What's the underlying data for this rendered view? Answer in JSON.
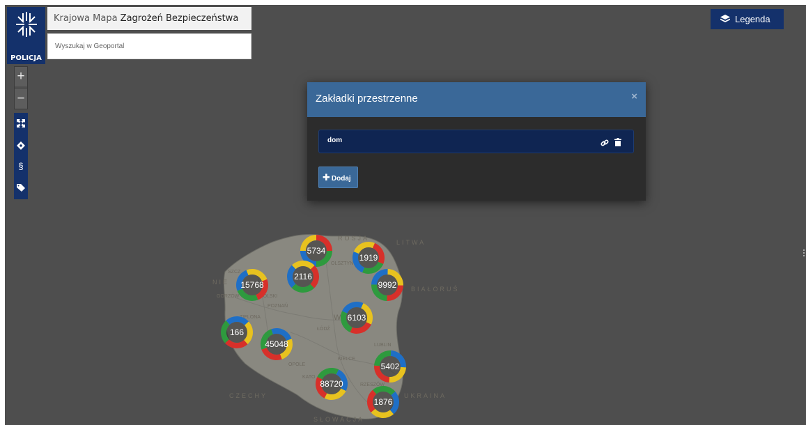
{
  "header": {
    "logo_text": "POLICJA",
    "title_prefix": "Krajowa Mapa ",
    "title_strong": "Zagrożeń Bezpieczeństwa",
    "search_placeholder": "Wyszukaj w Geoportal"
  },
  "zoom": {
    "in": "+",
    "out": "−"
  },
  "toolbar": {
    "items": [
      {
        "icon": "expand-icon"
      },
      {
        "icon": "locate-icon"
      },
      {
        "icon": "paragraph-icon",
        "glyph": "§"
      },
      {
        "icon": "tags-icon"
      }
    ]
  },
  "legend_button": {
    "label": "Legenda",
    "icon": "layers-icon"
  },
  "modal": {
    "title": "Zakładki przestrzenne",
    "close": "×",
    "bookmarks": [
      {
        "name": "dom"
      }
    ],
    "add_label": "Dodaj"
  },
  "map": {
    "labels": {
      "rosja": "ROSJA",
      "litwa": "LITWA",
      "bialorus": "BIAŁORUŚ",
      "niemcy": "NIE",
      "czechy": "CZECHY",
      "ukraina": "UKRAINA",
      "slowacja": "SŁOWACJA",
      "olsztyn": "OLSZTYN",
      "szczecin": "SZCZ",
      "gorzow": "GORZÓW",
      "poznan": "POZNAŃ",
      "zielona": "ZIELONA",
      "lodz": "ŁÓDŹ",
      "lublin": "LUBLIN",
      "kielce": "KIELCE",
      "opole": "OPOLE",
      "kato": "KATO",
      "rzeszow": "RZESZÓW",
      "polski": "POLSKI",
      "w": "W"
    },
    "clusters": [
      {
        "label": "5734"
      },
      {
        "label": "1919"
      },
      {
        "label": "2116"
      },
      {
        "label": "15768"
      },
      {
        "label": "9992"
      },
      {
        "label": "6103"
      },
      {
        "label": "166"
      },
      {
        "label": "45048"
      },
      {
        "label": "5402"
      },
      {
        "label": "88720"
      },
      {
        "label": "1876"
      }
    ],
    "cluster_colors": [
      "#d7302a",
      "#2e9a3e",
      "#1f6fc6",
      "#e8c21f"
    ]
  }
}
